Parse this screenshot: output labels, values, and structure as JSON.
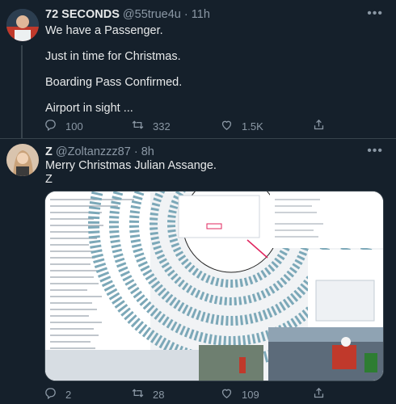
{
  "tweets": [
    {
      "display_name": "72 SECONDS",
      "handle": "@55true4u",
      "separator": "·",
      "time": "11h",
      "lines": [
        "We have a Passenger.",
        "Just in time for Christmas.",
        "Boarding Pass Confirmed.",
        "Airport in sight ..."
      ],
      "replies": "100",
      "retweets": "332",
      "likes": "1.5K",
      "more": "•••"
    },
    {
      "display_name": "Z",
      "handle": "@Zoltanzzz87",
      "separator": "·",
      "time": "8h",
      "lines": [
        "Merry Christmas Julian Assange.",
        "Z"
      ],
      "replies": "2",
      "retweets": "28",
      "likes": "109",
      "more": "•••"
    }
  ],
  "icons": {
    "reply": "reply-icon",
    "retweet": "retweet-icon",
    "like": "heart-icon",
    "share": "share-icon"
  },
  "colors": {
    "background": "#15202b",
    "text": "#e7e9ea",
    "muted": "#8b98a5",
    "divider": "#38444d"
  }
}
